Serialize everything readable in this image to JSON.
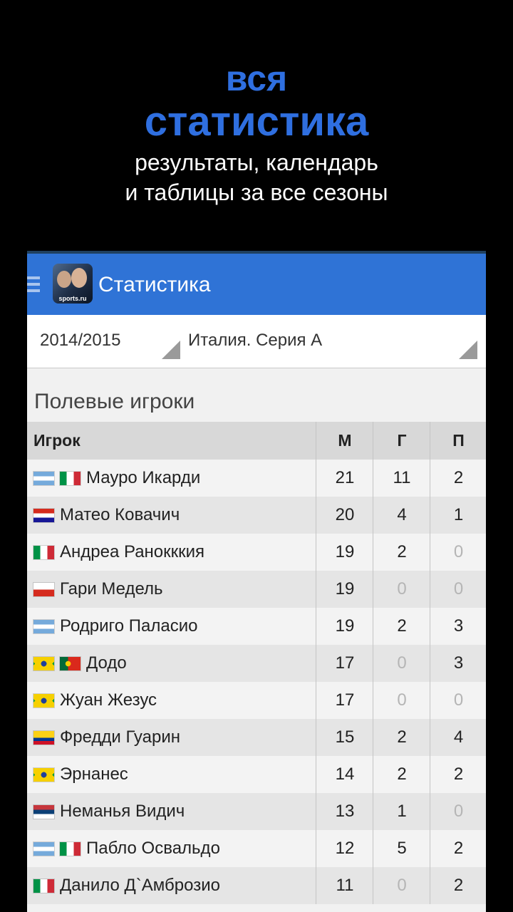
{
  "promo": {
    "title_line1": "вся",
    "title_line2": "статистика",
    "subtitle_line1": "результаты, календарь",
    "subtitle_line2": "и таблицы за все сезоны"
  },
  "app": {
    "title": "Статистика",
    "logo_text": "sports.ru",
    "colors": {
      "appbar": "#2f73d6",
      "promo_title": "#2f6fe0"
    }
  },
  "filters": {
    "season": "2014/2015",
    "league": "Италия. Серия А"
  },
  "section_title": "Полевые игроки",
  "table": {
    "headers": {
      "player": "Игрок",
      "m": "М",
      "g": "Г",
      "p": "П"
    },
    "rows": [
      {
        "flags": [
          "argentina",
          "italy"
        ],
        "name": "Мауро Икарди",
        "m": "21",
        "g": "11",
        "p": "2"
      },
      {
        "flags": [
          "croatia"
        ],
        "name": "Матео Ковачич",
        "m": "20",
        "g": "4",
        "p": "1"
      },
      {
        "flags": [
          "italy"
        ],
        "name": "Андреа Ранокккия",
        "m": "19",
        "g": "2",
        "p": "0"
      },
      {
        "flags": [
          "chile"
        ],
        "name": "Гари Медель",
        "m": "19",
        "g": "0",
        "p": "0"
      },
      {
        "flags": [
          "argentina"
        ],
        "name": "Родриго Паласио",
        "m": "19",
        "g": "2",
        "p": "3"
      },
      {
        "flags": [
          "brazil",
          "portugal"
        ],
        "name": "Додо",
        "m": "17",
        "g": "0",
        "p": "3"
      },
      {
        "flags": [
          "brazil"
        ],
        "name": "Жуан Жезус",
        "m": "17",
        "g": "0",
        "p": "0"
      },
      {
        "flags": [
          "colombia"
        ],
        "name": "Фредди Гуарин",
        "m": "15",
        "g": "2",
        "p": "4"
      },
      {
        "flags": [
          "brazil"
        ],
        "name": "Эрнанес",
        "m": "14",
        "g": "2",
        "p": "2"
      },
      {
        "flags": [
          "serbia"
        ],
        "name": "Неманья Видич",
        "m": "13",
        "g": "1",
        "p": "0"
      },
      {
        "flags": [
          "argentina",
          "italy"
        ],
        "name": "Пабло Освальдо",
        "m": "12",
        "g": "5",
        "p": "2"
      },
      {
        "flags": [
          "italy"
        ],
        "name": "Данило Д`Амброзио",
        "m": "11",
        "g": "0",
        "p": "2"
      }
    ]
  }
}
